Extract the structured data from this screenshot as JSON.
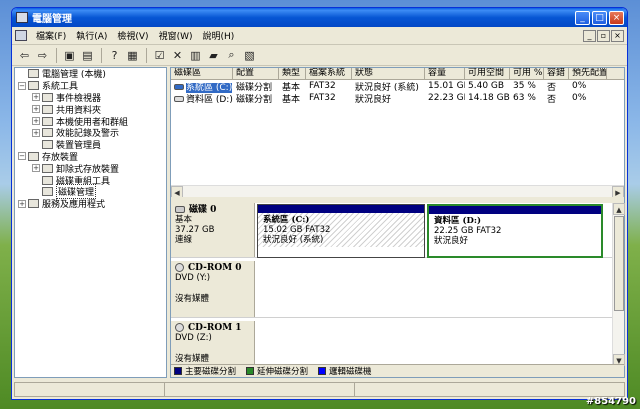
{
  "window": {
    "title": "電腦管理"
  },
  "menu": {
    "items": [
      "檔案(F)",
      "執行(A)",
      "檢視(V)",
      "視窗(W)",
      "說明(H)"
    ]
  },
  "tree": {
    "items": [
      {
        "label": "電腦管理 (本機)",
        "level": 0,
        "expander": ""
      },
      {
        "label": "系統工具",
        "level": 0,
        "expander": "−"
      },
      {
        "label": "事件檢視器",
        "level": 1,
        "expander": "+"
      },
      {
        "label": "共用資料夾",
        "level": 1,
        "expander": "+"
      },
      {
        "label": "本機使用者和群組",
        "level": 1,
        "expander": "+"
      },
      {
        "label": "效能記錄及警示",
        "level": 1,
        "expander": "+"
      },
      {
        "label": "裝置管理員",
        "level": 1,
        "expander": ""
      },
      {
        "label": "存放裝置",
        "level": 0,
        "expander": "−"
      },
      {
        "label": "卸除式存放裝置",
        "level": 1,
        "expander": "+"
      },
      {
        "label": "磁碟重組工具",
        "level": 1,
        "expander": ""
      },
      {
        "label": "磁碟管理",
        "level": 1,
        "expander": "",
        "selected": true
      },
      {
        "label": "服務及應用程式",
        "level": 0,
        "expander": "+"
      }
    ]
  },
  "volume_list": {
    "headers": [
      "磁碟區",
      "配置",
      "類型",
      "檔案系統",
      "狀態",
      "容量",
      "可用空間",
      "可用 %",
      "容錯",
      "預先配置"
    ],
    "rows": [
      [
        "系統區 (C:)",
        "磁碟分割",
        "基本",
        "FAT32",
        "狀況良好 (系統)",
        "15.01 GB",
        "5.40 GB",
        "35 %",
        "否",
        "0%"
      ],
      [
        "資料區 (D:)",
        "磁碟分割",
        "基本",
        "FAT32",
        "狀況良好",
        "22.23 GB",
        "14.18 GB",
        "63 %",
        "否",
        "0%"
      ]
    ]
  },
  "disks": [
    {
      "name": "磁碟 0",
      "type": "基本",
      "size": "37.27 GB",
      "status": "連線",
      "partitions": [
        {
          "name": "系統區  (C:)",
          "detail": "15.02 GB FAT32",
          "status": "狀況良好 (系統)"
        },
        {
          "name": "資料區  (D:)",
          "detail": "22.25 GB FAT32",
          "status": "狀況良好"
        }
      ]
    },
    {
      "name": "CD-ROM 0",
      "type": "DVD (Y:)",
      "media": "沒有媒體"
    },
    {
      "name": "CD-ROM 1",
      "type": "DVD (Z:)",
      "media": "沒有媒體"
    }
  ],
  "legend": [
    {
      "label": "主要磁碟分割",
      "color": "#000080"
    },
    {
      "label": "延伸磁碟分割",
      "color": "#2a8a2a"
    },
    {
      "label": "邏輯磁碟機",
      "color": "#0000ff"
    }
  ],
  "watermark": "#854790"
}
